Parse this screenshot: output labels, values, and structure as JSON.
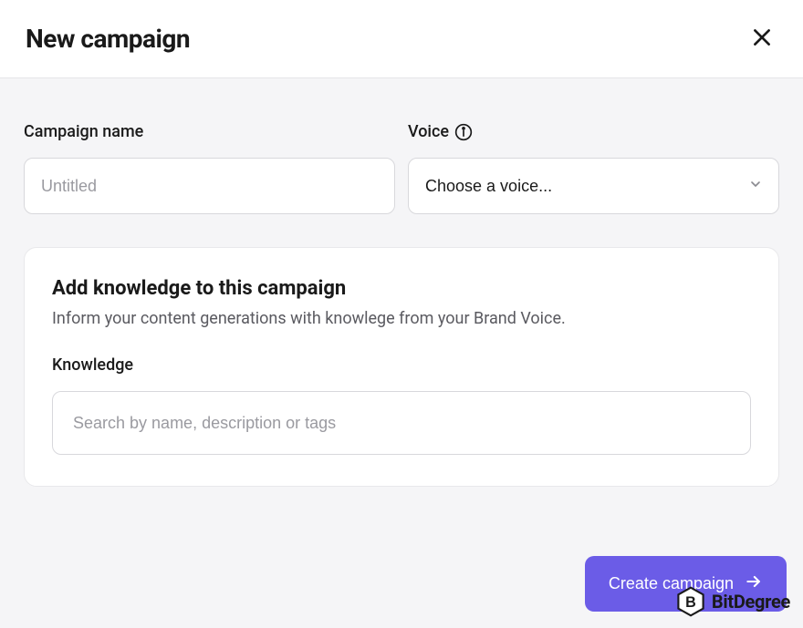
{
  "header": {
    "title": "New campaign"
  },
  "form": {
    "campaign_name": {
      "label": "Campaign name",
      "placeholder": "Untitled",
      "value": ""
    },
    "voice": {
      "label": "Voice",
      "placeholder": "Choose a voice...",
      "value": ""
    }
  },
  "knowledge_card": {
    "title": "Add knowledge to this campaign",
    "subtitle": "Inform your content generations with knowlege from your Brand Voice.",
    "field_label": "Knowledge",
    "search_placeholder": "Search by name, description or tags",
    "search_value": ""
  },
  "footer": {
    "create_button": "Create campaign"
  },
  "watermark": {
    "text": "BitDegree"
  }
}
